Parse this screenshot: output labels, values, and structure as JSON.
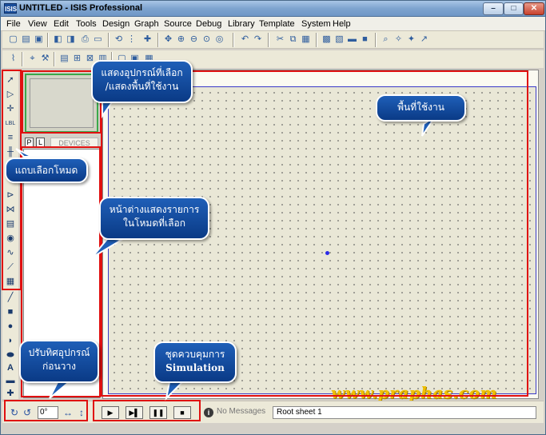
{
  "window": {
    "icon_text": "ISIS",
    "title": "UNTITLED - ISIS Professional",
    "min_label": "–",
    "max_label": "□",
    "close_label": "✕"
  },
  "menu": [
    "File",
    "View",
    "Edit",
    "Tools",
    "Design",
    "Graph",
    "Source",
    "Debug",
    "Library",
    "Template",
    "System",
    "Help"
  ],
  "device_panel": {
    "tab_p": "P",
    "tab_l": "L",
    "label": "DEVICES"
  },
  "status": {
    "angle_value": "0°",
    "no_messages": "No Messages",
    "sheet": "Root sheet 1",
    "info_icon_text": "i"
  },
  "watermark": "www.praphas.com",
  "callouts": {
    "overview": [
      "แสดงอุปกรณ์ที่เลือก",
      "/แสดงพื้นที่ใช้งาน"
    ],
    "workarea": [
      "พื้นที่ใช้งาน"
    ],
    "modebar": [
      "แถบเลือกโหมด"
    ],
    "devlist": [
      "หน้าต่างแสดงรายการ",
      "ในโหมดที่เลือก"
    ],
    "orientation": [
      "ปรับทิศอุปกรณ์",
      "ก่อนวาง"
    ],
    "simulation": [
      "ชุดควบคุมการ",
      "Simulation"
    ]
  },
  "colors": {
    "annotation_frame": "#e01010",
    "callout_fill": "#1f5fb8",
    "grid_fill": "#e9e7d6",
    "watermark": "#f0c000"
  }
}
